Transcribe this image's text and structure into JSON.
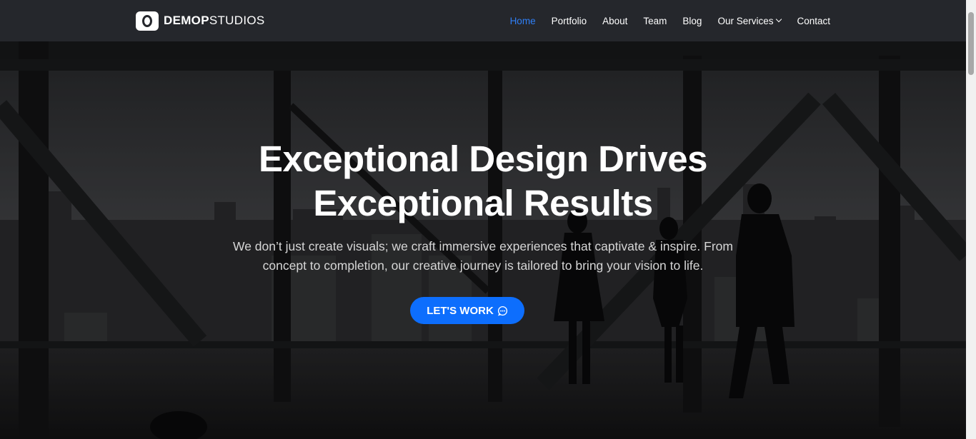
{
  "brand": {
    "name_bold": "DEMOP",
    "name_light": "STUDIOS"
  },
  "nav": {
    "items": [
      {
        "label": "Home",
        "active": true
      },
      {
        "label": "Portfolio"
      },
      {
        "label": "About"
      },
      {
        "label": "Team"
      },
      {
        "label": "Blog"
      },
      {
        "label": "Our Services",
        "has_dropdown": true
      },
      {
        "label": "Contact"
      }
    ]
  },
  "hero": {
    "title_line1": "Exceptional Design Drives",
    "title_line2": "Exceptional Results",
    "subtitle_line1": "We don’t just create visuals; we craft immersive experiences that captivate & inspire. From",
    "subtitle_line2": "concept to completion, our creative journey is tailored to bring your vision to life.",
    "cta_label": "LET'S WORK",
    "cta_icon": "chat-bubble-icon"
  },
  "colors": {
    "header_bg": "#25272c",
    "accent": "#0d6efd",
    "active_nav": "#2f7ff6"
  }
}
